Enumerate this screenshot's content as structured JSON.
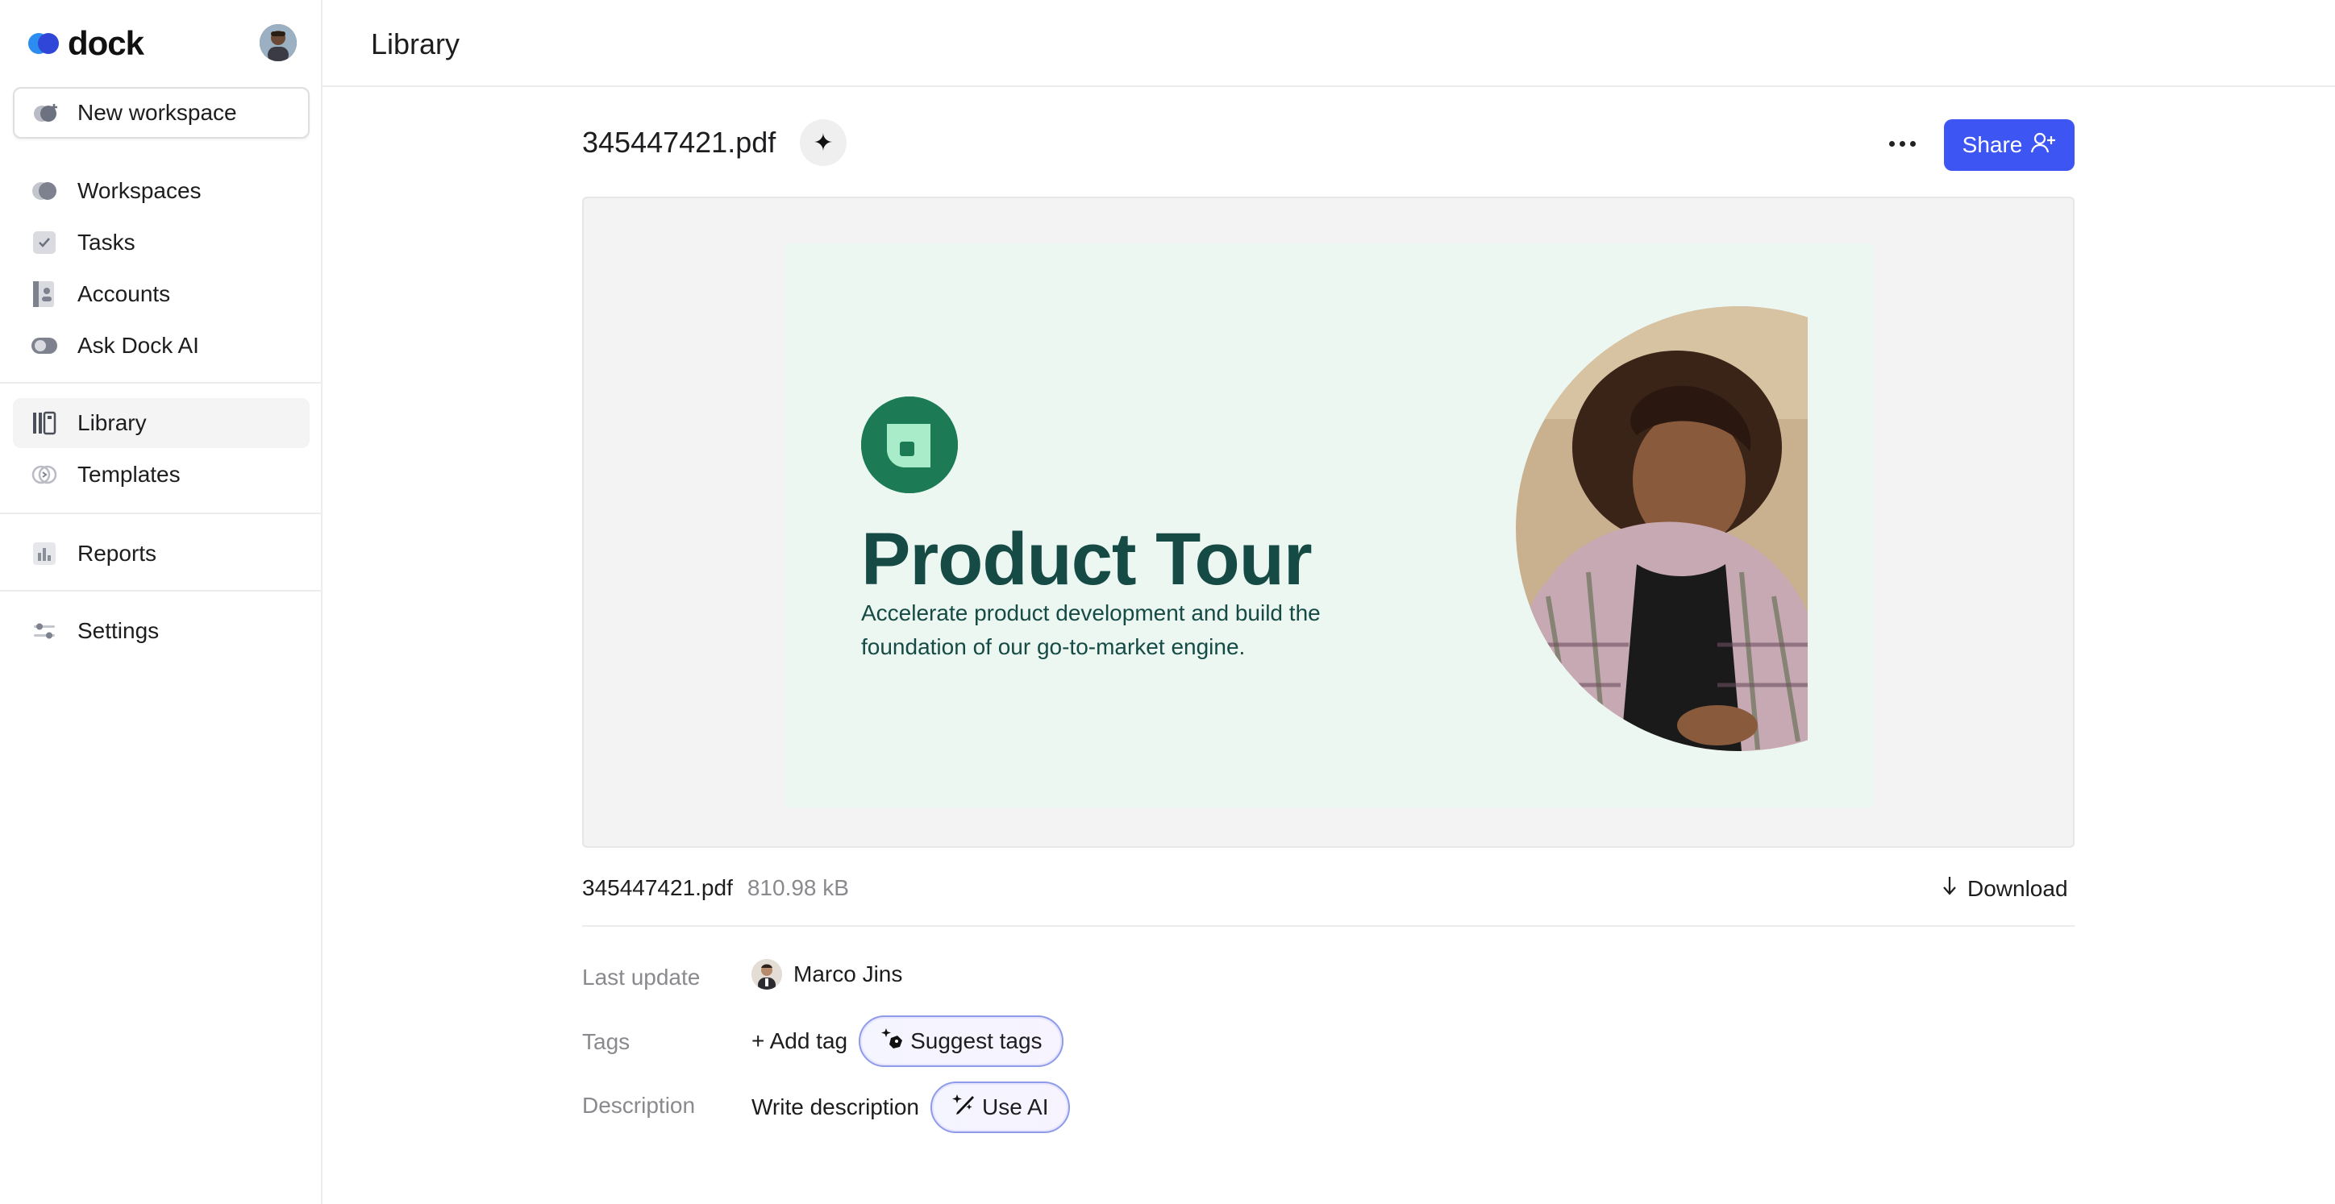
{
  "app": {
    "brand_name": "dock",
    "accent_color": "#3d55f2"
  },
  "sidebar": {
    "new_workspace_label": "New workspace",
    "items": [
      {
        "label": "Workspaces",
        "icon": "workspaces-icon"
      },
      {
        "label": "Tasks",
        "icon": "tasks-checkbox-icon"
      },
      {
        "label": "Accounts",
        "icon": "accounts-icon"
      },
      {
        "label": "Ask Dock AI",
        "icon": "ask-ai-icon"
      },
      {
        "label": "Library",
        "icon": "library-icon",
        "active": true
      },
      {
        "label": "Templates",
        "icon": "templates-icon"
      },
      {
        "label": "Reports",
        "icon": "reports-chart-icon"
      },
      {
        "label": "Settings",
        "icon": "settings-sliders-icon"
      }
    ]
  },
  "header": {
    "title": "Library"
  },
  "file": {
    "name": "345447421.pdf",
    "size": "810.98 kB",
    "share_label": "Share",
    "download_label": "Download"
  },
  "preview": {
    "slide_title": "Product Tour",
    "slide_subtitle": "Accelerate product development and build the foundation of our go-to-market engine."
  },
  "details": {
    "last_update_label": "Last update",
    "last_update_user": "Marco Jins",
    "tags_label": "Tags",
    "add_tag_label": "+ Add tag",
    "suggest_tags_label": "Suggest tags",
    "description_label": "Description",
    "write_description_label": "Write description",
    "use_ai_label": "Use AI"
  }
}
